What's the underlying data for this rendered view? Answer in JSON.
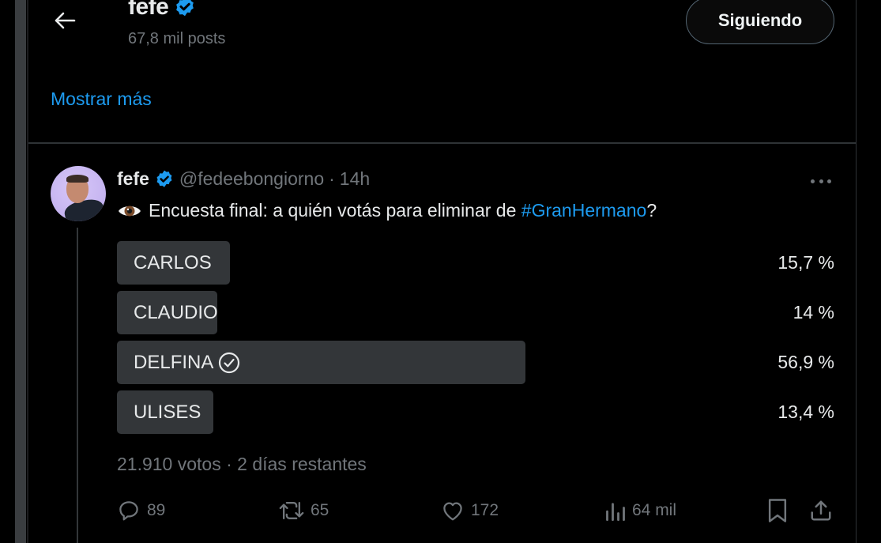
{
  "header": {
    "back_label": "Volver",
    "profile_name": "fefe",
    "post_count": "67,8 mil posts",
    "follow_button": "Siguiendo"
  },
  "bio": {
    "show_more": "Mostrar más"
  },
  "tweet": {
    "author_name": "fefe",
    "handle": "@fedeebongiorno",
    "separator": "·",
    "time": "14h",
    "text_before": "Encuesta final: a quién votás para eliminar de ",
    "hashtag": "#GranHermano",
    "text_after": "?",
    "poll": {
      "options": [
        {
          "label": "CARLOS",
          "percent_text": "15,7 %",
          "percent": 15.7,
          "winner": false
        },
        {
          "label": "CLAUDIO",
          "percent_text": "14 %",
          "percent": 14,
          "winner": false
        },
        {
          "label": "DELFINA",
          "percent_text": "56,9 %",
          "percent": 56.9,
          "winner": true
        },
        {
          "label": "ULISES",
          "percent_text": "13,4 %",
          "percent": 13.4,
          "winner": false
        }
      ],
      "meta": "21.910 votos · 2 días restantes"
    },
    "actions": {
      "replies": "89",
      "reposts": "65",
      "likes": "172",
      "views": "64 mil"
    }
  },
  "colors": {
    "accent": "#1d9bf0",
    "text": "#e7e9ea",
    "muted": "#71767b",
    "poll_bar": "#333639",
    "border": "#2f3336",
    "background": "#000000"
  }
}
